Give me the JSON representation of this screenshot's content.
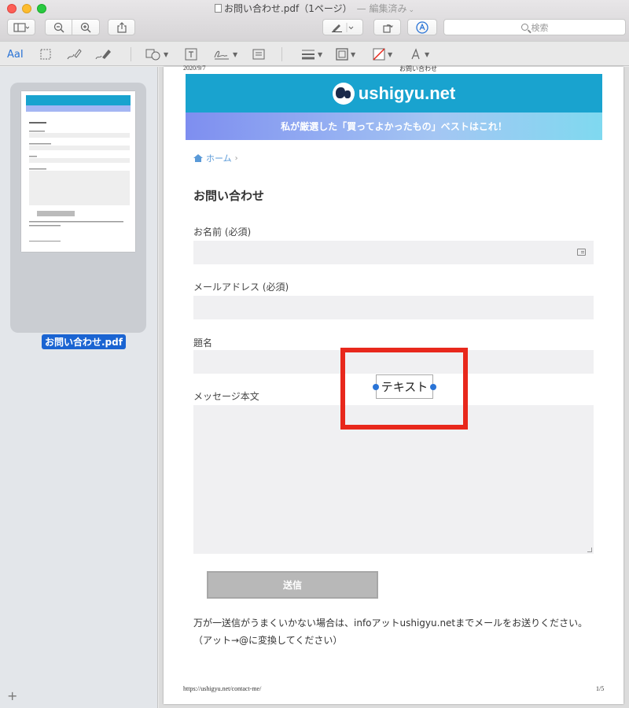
{
  "window": {
    "title": "お問い合わせ.pdf（1ページ）",
    "edited_label": "— 編集済み",
    "chevron": "⌄"
  },
  "toolbar": {
    "search_placeholder": "検索"
  },
  "markup": {
    "text_tool_label": "AaI"
  },
  "sidebar": {
    "thumbnail_label": "お問い合わせ.pdf",
    "add_symbol": "+"
  },
  "page": {
    "header_date": "2020/9/7",
    "header_title": "お問い合わせ",
    "site_name": "ushigyu.net",
    "tagline": "私が厳選した「買ってよかったもの」ベストはこれ！",
    "breadcrumb_home": "ホーム",
    "breadcrumb_sep": "›",
    "form_title": "お問い合わせ",
    "fields": {
      "name_label": "お名前 (必須)",
      "email_label": "メールアドレス (必須)",
      "subject_label": "題名",
      "message_label": "メッセージ本文"
    },
    "submit_label": "送信",
    "note_line1": "万が一送信がうまくいかない場合は、infoアットushigyu.netまでメールをお送りください。",
    "note_line2": "（アット→@に変換してください）",
    "footer_url": "https://ushigyu.net/contact-me/",
    "footer_page": "1/5"
  },
  "annotation": {
    "text_box": "テキスト",
    "highlight_color": "#e8281c"
  },
  "colors": {
    "banner": "#19a3cf",
    "selection_blue": "#1a64d2"
  }
}
